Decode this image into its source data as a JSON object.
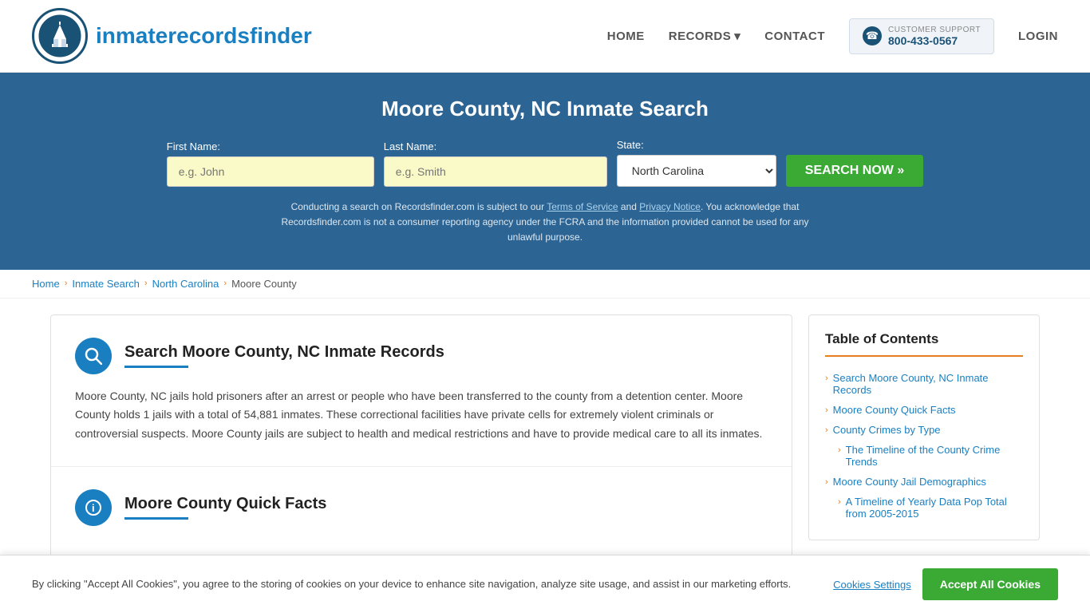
{
  "header": {
    "logo_text_normal": "inmaterecords",
    "logo_text_bold": "finder",
    "nav": {
      "home": "HOME",
      "records": "RECORDS",
      "contact": "CONTACT",
      "login": "LOGIN"
    },
    "support": {
      "label": "CUSTOMER SUPPORT",
      "number": "800-433-0567"
    }
  },
  "hero": {
    "title": "Moore County, NC Inmate Search",
    "form": {
      "first_name_label": "First Name:",
      "first_name_placeholder": "e.g. John",
      "last_name_label": "Last Name:",
      "last_name_placeholder": "e.g. Smith",
      "state_label": "State:",
      "state_value": "North Carolina",
      "search_button": "SEARCH NOW »"
    },
    "disclaimer": "Conducting a search on Recordsfinder.com is subject to our Terms of Service and Privacy Notice. You acknowledge that Recordsfinder.com is not a consumer reporting agency under the FCRA and the information provided cannot be used for any unlawful purpose."
  },
  "breadcrumb": {
    "home": "Home",
    "inmate_search": "Inmate Search",
    "state": "North Carolina",
    "county": "Moore County"
  },
  "article": {
    "section1": {
      "title": "Search Moore County, NC Inmate Records",
      "text": "Moore County, NC jails hold prisoners after an arrest or people who have been transferred to the county from a detention center. Moore County holds 1 jails with a total of 54,881 inmates. These correctional facilities have private cells for extremely violent criminals or controversial suspects. Moore County jails are subject to health and medical restrictions and have to provide medical care to all its inmates."
    }
  },
  "sidebar": {
    "toc_title": "Table of Contents",
    "items": [
      {
        "label": "Search Moore County, NC Inmate Records",
        "sub": false
      },
      {
        "label": "Moore County Quick Facts",
        "sub": false
      },
      {
        "label": "County Crimes by Type",
        "sub": false
      },
      {
        "label": "The Timeline of the County Crime Trends",
        "sub": true
      },
      {
        "label": "Moore County Jail Demographics",
        "sub": false
      },
      {
        "label": "A Timeline of Yearly Data Pop Total from 2005-2015",
        "sub": true
      }
    ]
  },
  "cookie_banner": {
    "text": "By clicking \"Accept All Cookies\", you agree to the storing of cookies on your device to enhance site navigation, analyze site usage, and assist in our marketing efforts.",
    "settings_btn": "Cookies Settings",
    "accept_btn": "Accept All Cookies"
  }
}
